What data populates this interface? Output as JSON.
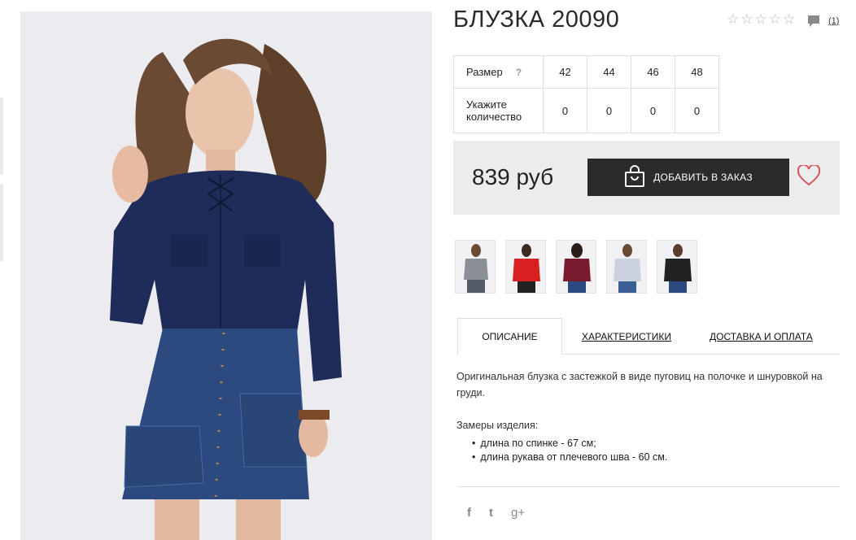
{
  "product": {
    "title": "БЛУЗКА 20090",
    "rating_stars": 5,
    "review_count": "(1)",
    "price": "839 руб"
  },
  "sizes": {
    "size_label": "Размер",
    "help": "?",
    "values": [
      "42",
      "44",
      "46",
      "48"
    ],
    "qty_label": "Укажите количество",
    "qty": [
      "0",
      "0",
      "0",
      "0"
    ]
  },
  "buttons": {
    "add_to_order": "ДОБАВИТЬ В ЗАКАЗ"
  },
  "thumbnail_colors": [
    "#8a9096",
    "#d8211e",
    "#7a1a2e",
    "#c9d2de",
    "#222222"
  ],
  "tabs": [
    {
      "label": "ОПИСАНИЕ"
    },
    {
      "label": "ХАРАКТЕРИСТИКИ"
    },
    {
      "label": "ДОСТАВКА И ОПЛАТА"
    }
  ],
  "description": {
    "text": "Оригинальная блузка с застежкой в виде пуговиц на полочке и шнуровкой на груди.",
    "measurements_title": "Замеры изделия:",
    "measurements": [
      "длина по спинке - 67 см;",
      "длина рукава от плечевого шва - 60 см."
    ]
  },
  "social": {
    "facebook": "f",
    "twitter": "t",
    "googleplus": "g+"
  },
  "icons": [
    "star-icon",
    "comment-icon",
    "shopping-bag-icon",
    "heart-icon",
    "facebook-icon",
    "twitter-icon",
    "google-plus-icon"
  ]
}
